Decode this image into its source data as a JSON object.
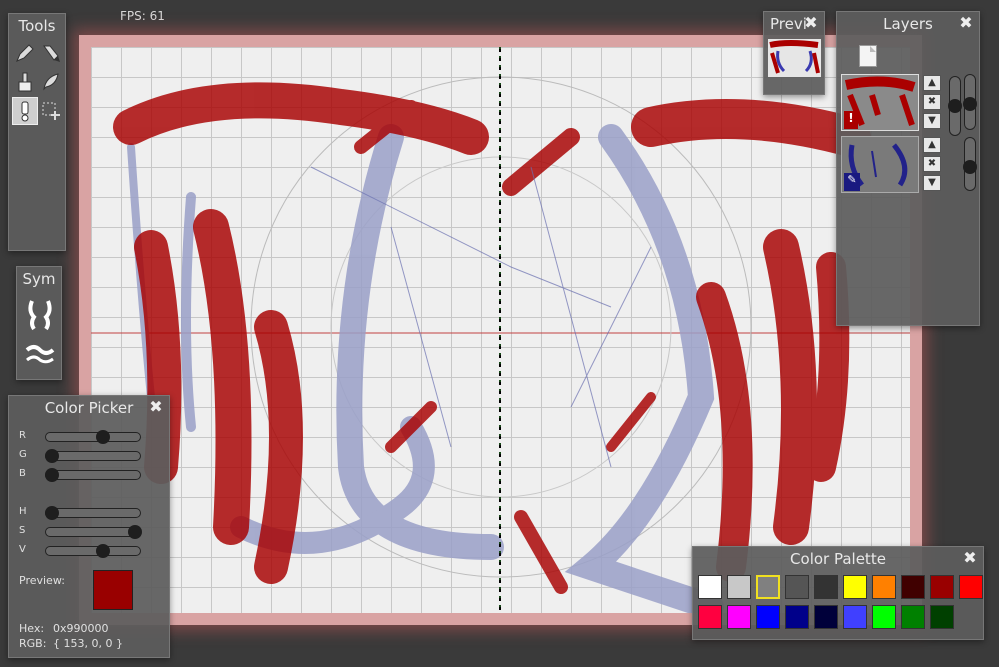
{
  "fps": "FPS: 61",
  "tools": {
    "title": "Tools",
    "items": [
      {
        "name": "pencil-tool",
        "icon": "pencil-icon"
      },
      {
        "name": "marker-tool",
        "icon": "marker-icon"
      },
      {
        "name": "brush-tool",
        "icon": "brush-icon"
      },
      {
        "name": "feather-tool",
        "icon": "feather-icon"
      },
      {
        "name": "exclamation-tool",
        "icon": "exclamation-icon"
      },
      {
        "name": "select-tool",
        "icon": "select-icon"
      }
    ]
  },
  "sym": {
    "title": "Sym"
  },
  "preview": {
    "title": "Previ"
  },
  "layers": {
    "title": "Layers"
  },
  "color_picker": {
    "title": "Color Picker",
    "rgb_labels": [
      "R",
      "G",
      "B"
    ],
    "hsv_labels": [
      "H",
      "S",
      "V"
    ],
    "rgb_values": [
      0.6,
      0.0,
      0.0
    ],
    "hsv_values": [
      0.0,
      1.0,
      0.6
    ],
    "preview_label": "Preview:",
    "hex_label": "Hex:",
    "hex_value": "0x990000",
    "rgb_label": "RGB:",
    "rgb_text": "{ 153, 0, 0 }",
    "preview_color": "#990000"
  },
  "color_palette": {
    "title": "Color Palette",
    "colors": [
      "#ffffff",
      "#c8c8c8",
      "#808080",
      "#555555",
      "#333333",
      "#ffff00",
      "#ff8000",
      "#400000",
      "#990000",
      "#ff0000",
      "#ff0040",
      "#ff00ff",
      "#0000ff",
      "#00008a",
      "#00003a",
      "#4040ff",
      "#00ff00",
      "#008000",
      "#004000"
    ],
    "selected_index": 2
  }
}
